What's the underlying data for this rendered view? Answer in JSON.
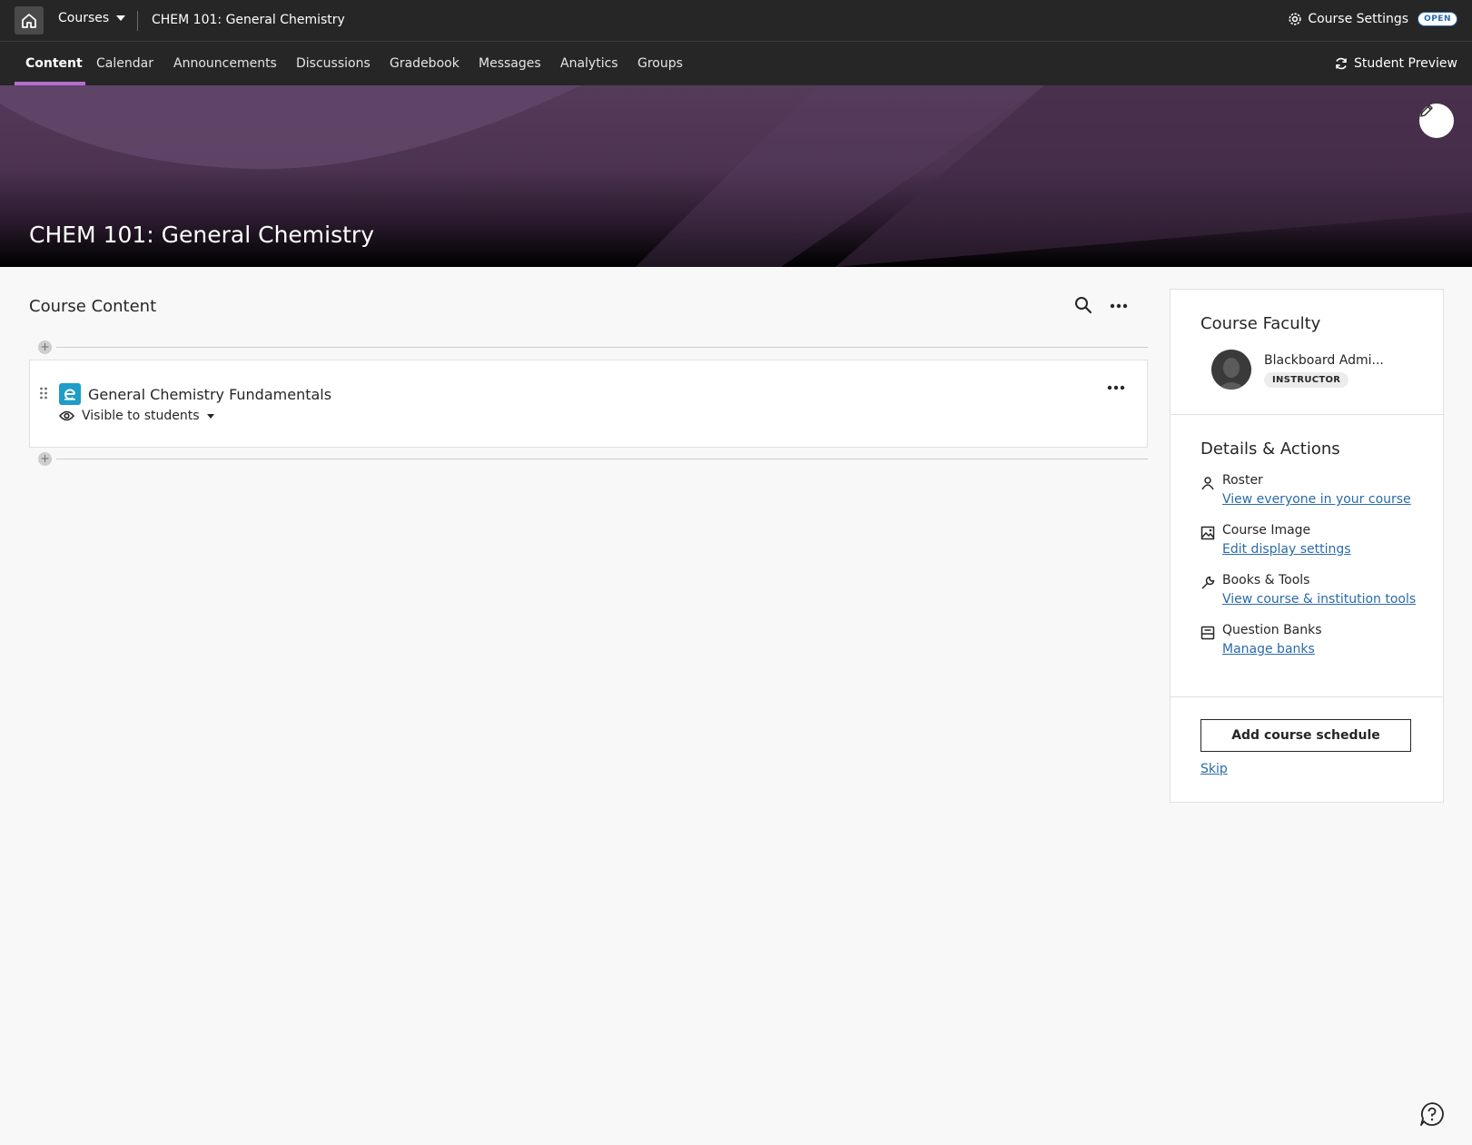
{
  "topbar": {
    "courses_label": "Courses",
    "course_name": "CHEM 101: General Chemistry",
    "settings_label": "Course Settings",
    "open_badge": "OPEN"
  },
  "nav": {
    "tabs": [
      {
        "label": "Content",
        "active": true
      },
      {
        "label": "Calendar"
      },
      {
        "label": "Announcements"
      },
      {
        "label": "Discussions"
      },
      {
        "label": "Gradebook"
      },
      {
        "label": "Messages"
      },
      {
        "label": "Analytics"
      },
      {
        "label": "Groups"
      }
    ],
    "student_preview": "Student Preview"
  },
  "banner": {
    "title": "CHEM 101: General Chemistry",
    "colors": {
      "base": "#553a5a",
      "dark": "#000000"
    }
  },
  "content": {
    "title": "Course Content",
    "items": [
      {
        "title": "General Chemistry Fundamentals",
        "icon": "ebook-icon",
        "visibility": "Visible to students"
      }
    ]
  },
  "faculty": {
    "title": "Course Faculty",
    "name": "Blackboard Admi...",
    "role": "INSTRUCTOR"
  },
  "details": {
    "title": "Details & Actions",
    "actions": [
      {
        "title": "Roster",
        "link": "View everyone in your course",
        "icon": "roster-icon"
      },
      {
        "title": "Course Image",
        "link": "Edit display settings",
        "icon": "image-icon"
      },
      {
        "title": "Books & Tools",
        "link": "View course & institution tools",
        "icon": "wrench-icon"
      },
      {
        "title": "Question Banks",
        "link": "Manage banks",
        "icon": "question-bank-icon"
      }
    ]
  },
  "schedule": {
    "button": "Add course schedule",
    "skip": "Skip"
  },
  "colors": {
    "accent": "#b56fcf",
    "link": "#2a6ba8",
    "topbar": "#262626",
    "ebook": "#1d9dc8"
  }
}
